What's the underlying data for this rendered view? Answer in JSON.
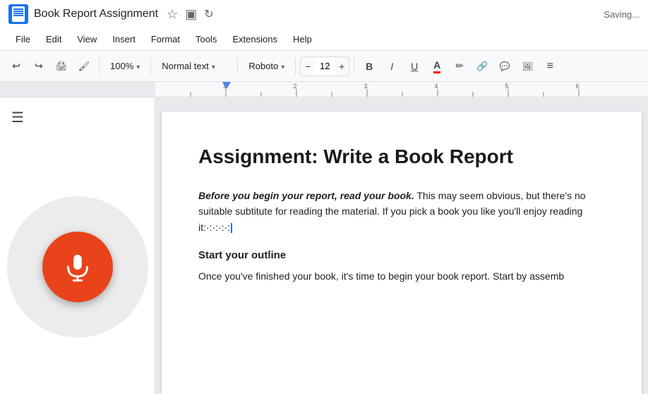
{
  "titleBar": {
    "docTitle": "Book Report Assignment",
    "savingText": "Saving...",
    "starLabel": "Star",
    "folderLabel": "Move",
    "syncLabel": "Sync"
  },
  "menuBar": {
    "items": [
      "File",
      "Edit",
      "View",
      "Insert",
      "Format",
      "Tools",
      "Extensions",
      "Help"
    ]
  },
  "toolbar": {
    "undoLabel": "Undo",
    "redoLabel": "Redo",
    "printLabel": "Print",
    "paintLabel": "Paint format",
    "zoomValue": "100%",
    "styleValue": "Normal text",
    "fontValue": "Roboto",
    "fontSizeValue": "12",
    "boldLabel": "B",
    "italicLabel": "I",
    "underlineLabel": "U",
    "textColorLabel": "A",
    "highlightLabel": "✏",
    "linkLabel": "🔗",
    "insertCommentLabel": "💬",
    "insertImageLabel": "🖼",
    "moreLabel": "≡"
  },
  "document": {
    "heading": "Assignment: Write a Book Report",
    "para1_start": "Before you begin your report, read your book.",
    "para1_end": " This may seem obvious, but there's no suitable subtitute for reading the material. If you pick a book you like you'll enjoy reading it:·:·:·:·:",
    "section1_title": "Start your outline",
    "section1_text": "Once you've finished your book, it's time to begin your book report. Start by assemb"
  },
  "voice": {
    "micLabel": "Voice typing"
  },
  "sidebar": {
    "outlineLabel": "Outline"
  }
}
